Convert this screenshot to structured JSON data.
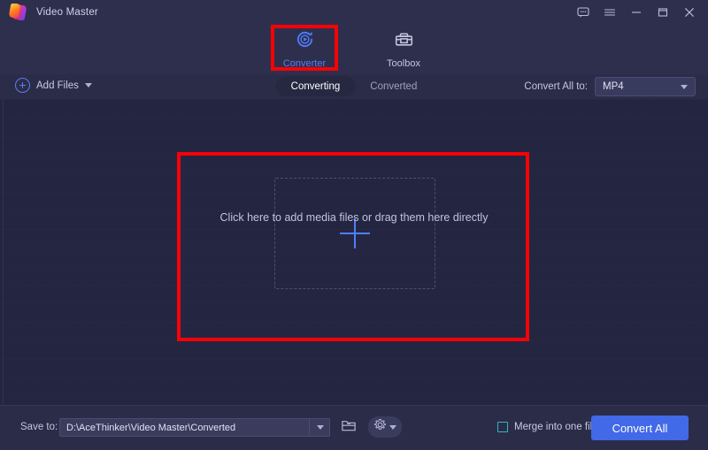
{
  "window": {
    "app_title": "Video Master",
    "controls": [
      {
        "name": "feedback-icon",
        "label": "Feedback"
      },
      {
        "name": "menu-icon",
        "label": "Menu"
      },
      {
        "name": "minimize-icon",
        "label": "Minimize"
      },
      {
        "name": "maximize-icon",
        "label": "Maximize"
      },
      {
        "name": "close-icon",
        "label": "Close"
      }
    ]
  },
  "tabs": [
    {
      "label": "Converter",
      "icon": "converter-icon",
      "active": true
    },
    {
      "label": "Toolbox",
      "icon": "toolbox-icon",
      "active": false
    }
  ],
  "toolbar": {
    "add_files_label": "Add Files",
    "add_files_icon": "plus-circle-icon",
    "add_files_caret": "chevron-down-icon",
    "segments": [
      {
        "label": "Converting",
        "active": true
      },
      {
        "label": "Converted",
        "active": false
      }
    ],
    "convert_all_to_label": "Convert All to:",
    "convert_all_to_value": "MP4"
  },
  "main": {
    "dropzone_plus_icon": "plus-icon",
    "dropzone_text": "Click here to add media files or drag them here directly"
  },
  "bottom": {
    "save_to_label": "Save to:",
    "save_to_path": "D:\\AceThinker\\Video Master\\Converted",
    "folder_icon": "folder-open-icon",
    "settings_icon": "gear-icon",
    "merge_label": "Merge into one file",
    "merge_checked": false,
    "convert_all_label": "Convert All"
  },
  "annotations": [
    {
      "name": "converter-tab-highlight",
      "color": "#fb0007"
    },
    {
      "name": "dropzone-highlight",
      "color": "#fb0007"
    }
  ],
  "colors": {
    "window_bg": "#22243f",
    "chrome_bg": "#2e2f4d",
    "main_bg": "#242641",
    "accent_blue": "#4f7dfb",
    "button_blue": "#4169e8",
    "checkbox_teal": "#2fb6c9",
    "annotation_red": "#fb0007"
  }
}
